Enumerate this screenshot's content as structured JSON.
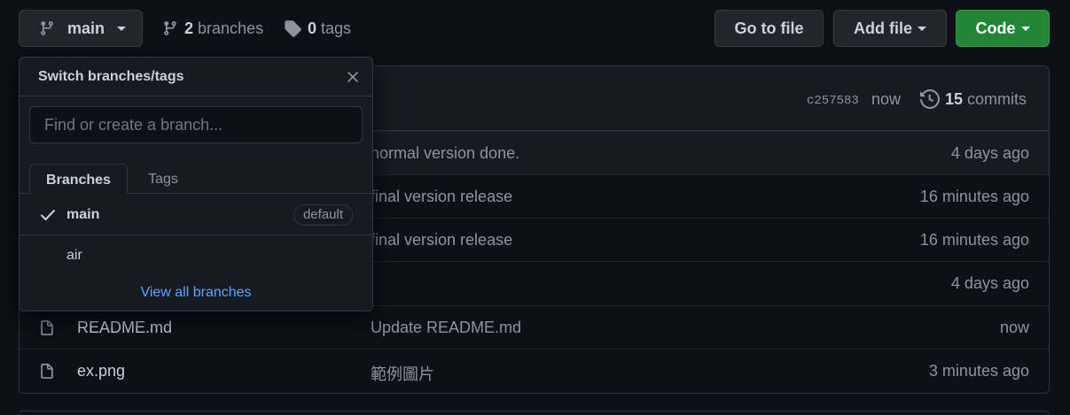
{
  "toolbar": {
    "branch_label": "main",
    "branches_count": "2",
    "branches_label": "branches",
    "tags_count": "0",
    "tags_label": "tags",
    "go_to_file": "Go to file",
    "add_file": "Add file",
    "code": "Code"
  },
  "commit_bar": {
    "sha": "c257583",
    "time": "now",
    "commits_count": "15",
    "commits_label": "commits"
  },
  "files": [
    {
      "name": "",
      "message": "normal version done.",
      "age": "4 days ago"
    },
    {
      "name": "",
      "message": "final version release",
      "age": "16 minutes ago"
    },
    {
      "name": "",
      "message": "final version release",
      "age": "16 minutes ago"
    },
    {
      "name": "",
      "message": "",
      "age": "4 days ago"
    },
    {
      "name": "README.md",
      "message": "Update README.md",
      "age": "now"
    },
    {
      "name": "ex.png",
      "message": "範例圖片",
      "age": "3 minutes ago"
    }
  ],
  "dropdown": {
    "title": "Switch branches/tags",
    "search_placeholder": "Find or create a branch...",
    "tab_branches": "Branches",
    "tab_tags": "Tags",
    "items": [
      {
        "label": "main",
        "badge": "default",
        "selected": true
      },
      {
        "label": "air",
        "badge": "",
        "selected": false
      }
    ],
    "view_all": "View all branches"
  },
  "colors": {
    "background": "#0d1117",
    "code_button": "#238636",
    "link": "#58a6ff"
  }
}
